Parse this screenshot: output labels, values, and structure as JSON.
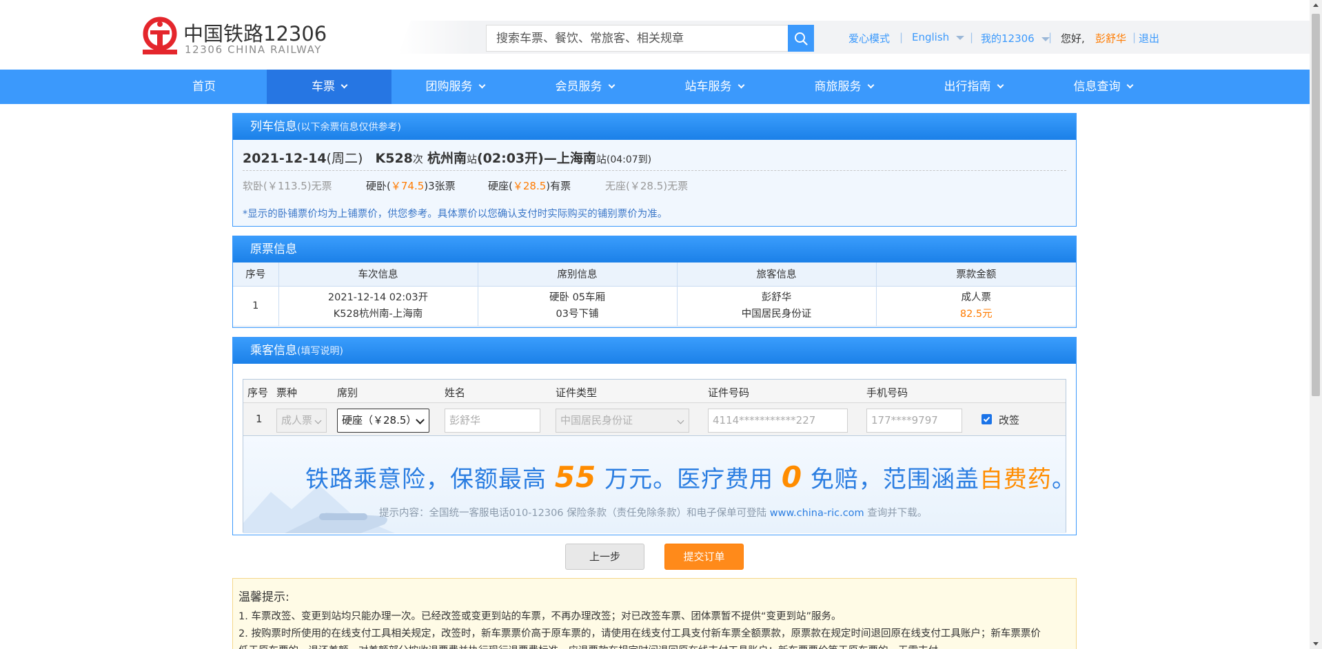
{
  "colors": {
    "brand_blue": "#3b99fc",
    "nav_active": "#2676e3",
    "accent_orange": "#ff7b00",
    "logo_red": "#e4262c"
  },
  "header": {
    "logo_cn": "中国铁路12306",
    "logo_en": "12306 CHINA RAILWAY",
    "search_placeholder": "搜索车票、餐饮、常旅客、相关规章",
    "links": {
      "care_mode": "爱心模式",
      "english": "English",
      "my12306": "我的12306",
      "greeting": "您好,",
      "username": "彭舒华",
      "logout": "退出"
    }
  },
  "nav": [
    "首页",
    "车票",
    "团购服务",
    "会员服务",
    "站车服务",
    "商旅服务",
    "出行指南",
    "信息查询"
  ],
  "train_info": {
    "title": "列车信息",
    "subtitle": "(以下余票信息仅供参考)",
    "date": "2021-12-14",
    "weekday": "(周二)",
    "train_no": "K528",
    "ci": "次",
    "from": "杭州南",
    "zhan": "站",
    "depart": "(02:03开)",
    "dash": "—",
    "to": "上海南",
    "arrive": "(04:07到)",
    "seats": [
      {
        "name": "软卧",
        "price": "(￥113.5)",
        "avail": "无票"
      },
      {
        "name": "硬卧",
        "price_open": "(",
        "price": "￥74.5",
        "price_close": ")",
        "avail": "3张票"
      },
      {
        "name": "硬座",
        "price_open": "(",
        "price": "￥28.5",
        "price_close": ")",
        "avail": "有票"
      },
      {
        "name": "无座",
        "price": "(￥28.5)",
        "avail": "无票"
      }
    ],
    "note": "*显示的卧铺票价均为上铺票价，供您参考。具体票价以您确认支付时实际购买的铺别票价为准。"
  },
  "original_ticket": {
    "title": "原票信息",
    "columns": [
      "序号",
      "车次信息",
      "席别信息",
      "旅客信息",
      "票款金额"
    ],
    "row": {
      "index": "1",
      "train_l1": "2021-12-14 02:03开",
      "train_l2": "K528杭州南-上海南",
      "seat_l1": "硬卧 05车厢",
      "seat_l2": "03号下铺",
      "pax_l1": "彭舒华",
      "pax_l2": "中国居民身份证",
      "fare_l1": "成人票",
      "fare_l2": "82.5元"
    }
  },
  "passenger": {
    "title": "乘客信息",
    "subtitle": "(填写说明)",
    "columns": [
      "序号",
      "票种",
      "席别",
      "姓名",
      "证件类型",
      "证件号码",
      "手机号码"
    ],
    "row": {
      "index": "1",
      "ticket_type": "成人票",
      "seat": "硬座（￥28.5）",
      "name": "彭舒华",
      "id_type": "中国居民身份证",
      "id_number": "4114***********227",
      "phone": "177****9797",
      "change_label": "改签",
      "change_checked": true
    }
  },
  "banner": {
    "t1": "铁路乘意险，保额最高 ",
    "t2": "55",
    "t3": " 万元。医疗费用 ",
    "t4": "0",
    "t5": " 免赔，范围涵盖",
    "t6": "自费药",
    "t7": "。",
    "sub": "提示内容：全国统一客服电话010-12306 保险条款（责任免除条款）和电子保单可登陆 ",
    "sub_link": "www.china-ric.com",
    "sub_end": " 查询并下载。"
  },
  "buttons": {
    "prev": "上一步",
    "submit": "提交订单"
  },
  "tips": {
    "title": "温馨提示:",
    "items": [
      "1. 车票改签、变更到站均只能办理一次。已经改签或变更到站的车票，不再办理改签；对已改签车票、团体票暂不提供“变更到站”服务。",
      "2. 按购票时所使用的在线支付工具相关规定，改签时，新车票票价高于原车票的，请使用在线支付工具支付新车票全额票款，原票款在规定时间退回原在线支付工具账户；新车票票价",
      "低于原车票的，退还差额，对差额部分按收退票费并执行现行退票费标准，应退票款在规定时间退回原在线支付工具账户；新车票票价等于原车票的，无需支付。"
    ]
  }
}
